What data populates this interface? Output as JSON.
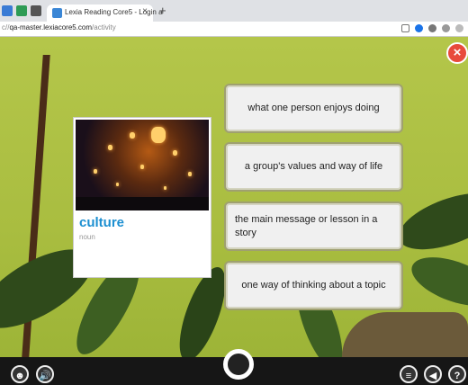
{
  "browser": {
    "tab_title": "Lexia Reading Core5 - Login a",
    "tab_close": "×",
    "new_tab": "+",
    "url_prefix": "c//",
    "url_host": "qa-master.lexiacore5.com",
    "url_path": "/activity"
  },
  "activity": {
    "close_symbol": "×",
    "card": {
      "word": "culture",
      "part_of_speech": "noun"
    },
    "choices": [
      "what one person enjoys doing",
      "a group's values and way of life",
      "the main message or lesson in a story",
      "one way of thinking about a topic"
    ]
  },
  "toolbar": {
    "help_symbol": "?"
  },
  "colors": {
    "background": "#a9bd40",
    "word_blue": "#1c8fd1",
    "close_red": "#e84b3c"
  }
}
